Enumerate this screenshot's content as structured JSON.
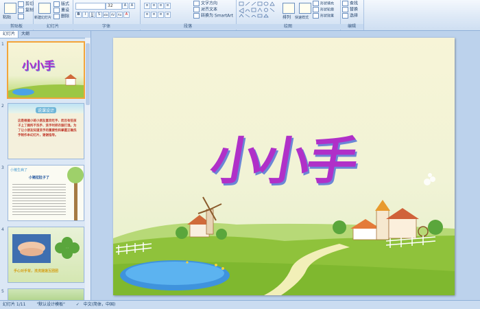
{
  "ribbon": {
    "clipboard": {
      "label": "剪贴板",
      "paste": "粘贴",
      "cut": "剪切",
      "copy": "复制",
      "format": "格式刷"
    },
    "slides": {
      "label": "幻灯片",
      "new_slide": "新建幻灯片",
      "layout": "版式",
      "reset": "重设",
      "delete": "删除"
    },
    "font": {
      "label": "字体",
      "size": "32",
      "buttons": [
        "B",
        "I",
        "U",
        "S",
        "abc",
        "AV",
        "Aa",
        "A"
      ]
    },
    "paragraph": {
      "label": "段落",
      "text_direction": "文字方向",
      "align_text": "对齐文本",
      "smartart": "转换为 SmartArt"
    },
    "drawing": {
      "label": "绘图",
      "arrange": "排列",
      "quick_styles": "快速样式",
      "fill": "形状填充",
      "outline": "形状轮廓",
      "effects": "形状效果"
    },
    "editing": {
      "label": "编辑",
      "find": "查找",
      "replace": "替换",
      "select": "选择"
    }
  },
  "panel": {
    "tabs": [
      "幻灯片",
      "大纲"
    ],
    "slides": [
      {
        "num": "1",
        "title": "小小手"
      },
      {
        "num": "2",
        "title": "说课设计",
        "text": "这是根据小班小朋友喜欢吃手、而且有些孩子上了厕所不洗手、洗手时把衣服打湿。为了让小朋友知道洗手的重要性和掌握正确洗手制作本幻灯片，谢谢指导。"
      },
      {
        "num": "3",
        "title": "小猪生病了",
        "heading": "小猪拉肚子了"
      },
      {
        "num": "4",
        "caption": "手心对手背，洗洗搓搓互团团"
      },
      {
        "num": "5"
      }
    ]
  },
  "slide": {
    "title": "小小手"
  },
  "status": {
    "slide_counter": "幻灯片 1/11",
    "theme": "\"默认设计模板\"",
    "language": "中文(简体，中国)"
  }
}
